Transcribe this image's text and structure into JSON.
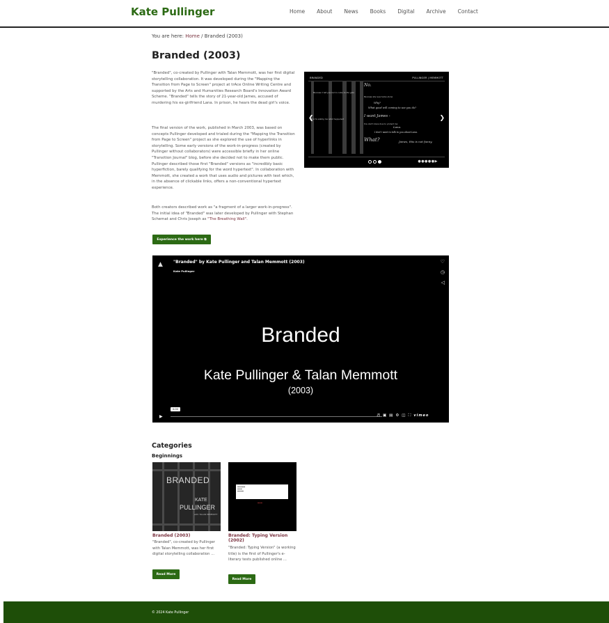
{
  "header": {
    "site_title": "Kate Pullinger",
    "nav": [
      "Home",
      "About",
      "News",
      "Books",
      "Digital",
      "Archive",
      "Contact"
    ]
  },
  "breadcrumb": {
    "prefix": "You are here:",
    "home": "Home",
    "separator": "/",
    "current": "Branded (2003)"
  },
  "page": {
    "title": "Branded (2003)",
    "para1": "\"Branded\", co-created by Pullinger with Talan Memmott, was her first digital storytelling collaboration. It was developed during the \"Mapping the Transition from Page to Screen\" project at trAce Online Writing Centre and supported by the Arts and Humanities Research Board's Innovation Award Scheme. \"Branded\" tells the story of 21-year-old James, accused of murdering his ex-girlfriend Lana. In prison, he hears the dead girl's voice.",
    "para2": "The final version of the work, published in March 2003, was based on concepts Pullinger developed and trialed during the \"Mapping the Transition from Page to Screen\" project as she explored the use of hyperlinks in storytelling. Some early versions of the work-in-progress (created by Pullinger without collaborators) were accessible briefly in her online \"Transition Journal\" blog, before she decided not to make them public. Pullinger described those first \"Branded\" versions as \"incredibly basic hyperfiction, barely qualifying for the word hypertext\". In collaboration with Memmott, she created a work that uses audio and pictures with text which, in the absence of clickable links, offers a non-conventional hypertext experience.",
    "para3_start": "Both creators described work as \"a fragment of a larger work-in-progress\". The initial idea of \"Branded\" was later developed by Pullinger with Stephan Schemat and Chris Joseph as ",
    "para3_link": "\"The Breathing Wall\"",
    "para3_end": ".",
    "experience_button": "Experience the work here ⧉"
  },
  "gallery": {
    "top_left": "BRANDED",
    "top_right": "PULLINGER | MEMMOTT",
    "lines": [
      "No.",
      "Why?",
      "What good will coming to see you do?",
      "I want James -",
      "Lana.",
      "I don't want to talk to you about Lana.",
      "What?",
      "James, this is not funny."
    ],
    "small_lines": [
      "Because I tell you not to come to the gate",
      "Because she was home alone",
      "You're asking me what happened",
      "You don't know how to protect me"
    ],
    "dots": [
      false,
      false,
      true
    ],
    "controls": "●●●●●▶"
  },
  "video": {
    "title": "\"Branded\" by Kate Pullinger and Talan Memmott (2003)",
    "author": "Kate Pullinger",
    "big_title": "Branded",
    "names": "Kate Pullinger & Talan Memmott",
    "year": "(2003)",
    "timestamp": "0:00",
    "vimeo": "vimeo",
    "icons": [
      "heart-icon",
      "clock-icon",
      "send-icon",
      "play-icon",
      "volume-icon",
      "cc-icon",
      "settings-icon",
      "pip-icon",
      "fullscreen-icon"
    ]
  },
  "categories": {
    "heading": "Categories",
    "subheading": "Beginnings",
    "cards": [
      {
        "title": "Branded (2003)",
        "text": "\"Branded\", co-created by Pullinger with Talan Memmott, was her first digital storytelling collaboration ...",
        "button": "Read More",
        "image": {
          "brand": "BRANDED",
          "kate": "KATE",
          "pullinger": "PULLINGER",
          "with": "with TALAN MEMMOTT"
        }
      },
      {
        "title": "Branded: Typing Version (2002)",
        "text": "\"Branded: Typing Version\" (a working title) is the first of Pullinger's e-literary tests published online ...",
        "button": "Read More"
      }
    ]
  },
  "footer": {
    "text": "© 2024 Kate Pullinger"
  },
  "colors": {
    "brand_green": "#2c6a14",
    "footer_green": "#1e4e08",
    "link": "#7a3340"
  }
}
